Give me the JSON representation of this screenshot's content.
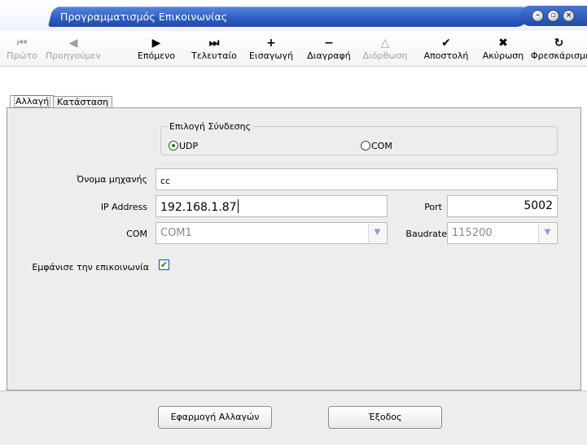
{
  "window": {
    "title": "Προγραμματισμός Επικοινωνίας",
    "buttons": [
      "minimize-icon",
      "restore-icon",
      "close-icon"
    ]
  },
  "toolbar": {
    "items": [
      {
        "label": "Πρώτο",
        "icon": "first-record-icon",
        "glyph": "⏮",
        "enabled": false
      },
      {
        "label": "Προηγούμενο",
        "icon": "previous-record-icon",
        "glyph": "◀",
        "enabled": false
      },
      {
        "label": "Επόμενο",
        "icon": "next-record-icon",
        "glyph": "▶",
        "enabled": true
      },
      {
        "label": "Τελευταίο",
        "icon": "last-record-icon",
        "glyph": "⏭",
        "enabled": true
      },
      {
        "label": "Εισαγωγή",
        "icon": "insert-icon",
        "glyph": "+",
        "enabled": true
      },
      {
        "label": "Διαγραφή",
        "icon": "delete-icon",
        "glyph": "−",
        "enabled": true
      },
      {
        "label": "Διόρθωση",
        "icon": "edit-icon",
        "glyph": "△",
        "enabled": false
      },
      {
        "label": "Αποστολή",
        "icon": "post-check-icon",
        "glyph": "✔",
        "enabled": true
      },
      {
        "label": "Ακύρωση",
        "icon": "cancel-x-icon",
        "glyph": "✖",
        "enabled": true
      },
      {
        "label": "Φρεσκάρισμα",
        "icon": "refresh-icon",
        "glyph": "↻",
        "enabled": true
      }
    ]
  },
  "tabs": [
    {
      "label": "Αλλαγή",
      "active": true
    },
    {
      "label": "Κατάσταση",
      "active": false
    }
  ],
  "connection": {
    "group_label": "Επιλογή Σύνδεσης",
    "options": [
      {
        "label": "UDP",
        "selected": true
      },
      {
        "label": "COM",
        "selected": false
      }
    ]
  },
  "form": {
    "machine_name_label": "Όνομα μηχανής",
    "machine_name_value": "cc",
    "ip_label": "IP Address",
    "ip_value": "192.168.1.87",
    "port_label": "Port",
    "port_value": "5002",
    "com_label": "COM",
    "com_value": "COM1",
    "baudrate_label": "Baudrate",
    "baudrate_value": "115200",
    "show_comm_label": "Εμφάνισε την επικοινωνία",
    "show_comm_checked": true
  },
  "footer": {
    "apply_label": "Εφαρμογή Αλλαγών",
    "exit_label": "Έξοδος"
  }
}
